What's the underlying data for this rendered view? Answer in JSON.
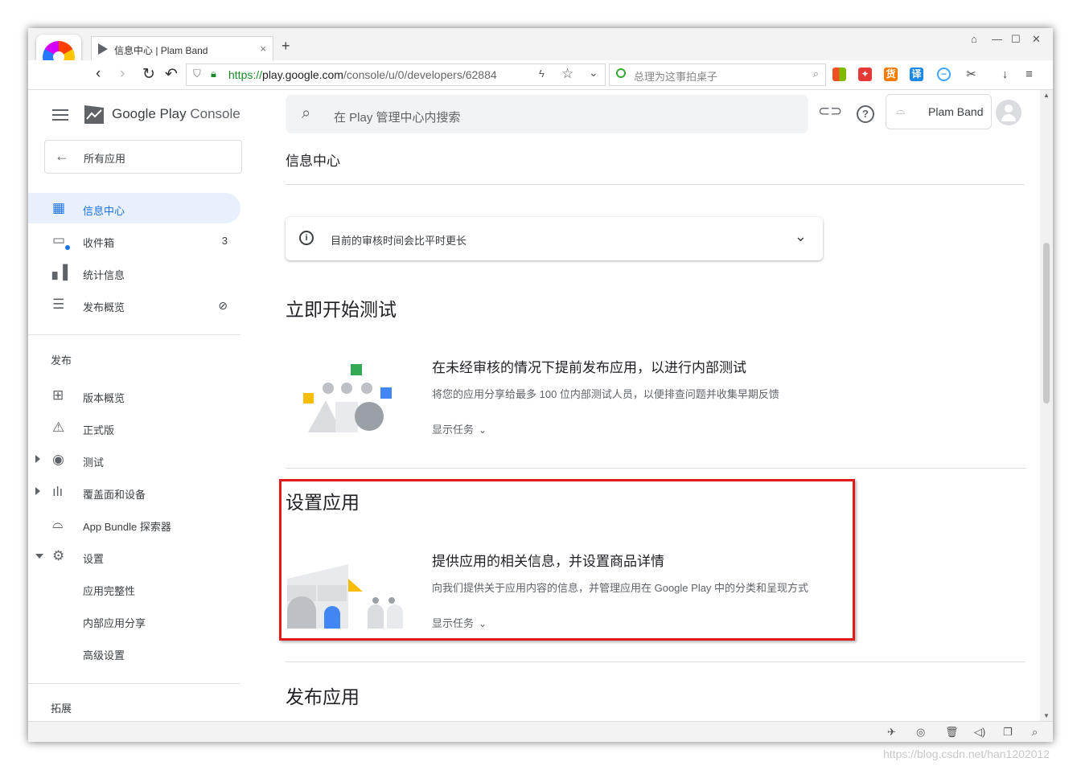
{
  "browser": {
    "tab_title": "信息中心 | Plam Band",
    "tab_close": "×",
    "new_tab": "+",
    "url_scheme": "https://",
    "url_host": "play.google.com",
    "url_path": "/console/u/0/developers/62884",
    "search_placeholder": "总理为这事拍桌子",
    "toolbar_icons": [
      "translate",
      "game",
      "deal",
      "translate-yi",
      "minus",
      "scissors",
      "download",
      "menu"
    ],
    "toolbar_glyphs": {
      "deal": "货",
      "translate": "译"
    }
  },
  "app": {
    "brand_main": "Google Play",
    "brand_sub": " Console",
    "all_apps": "所有应用",
    "search_placeholder": "在 Play 管理中心内搜索",
    "account_name": "Plam Band"
  },
  "sidebar": {
    "items": [
      {
        "label": "信息中心",
        "icon": "dashboard-icon"
      },
      {
        "label": "收件箱",
        "count": "3",
        "icon": "inbox-icon"
      },
      {
        "label": "统计信息",
        "icon": "stats-icon"
      },
      {
        "label": "发布概览",
        "icon": "release-overview-icon"
      }
    ],
    "section_release": "发布",
    "release_items": [
      {
        "label": "版本概览"
      },
      {
        "label": "正式版"
      },
      {
        "label": "测试"
      },
      {
        "label": "覆盖面和设备"
      },
      {
        "label": "App Bundle 探索器"
      },
      {
        "label": "设置"
      },
      {
        "label": "应用完整性"
      },
      {
        "label": "内部应用分享"
      },
      {
        "label": "高级设置"
      }
    ],
    "section_expand": "拓展"
  },
  "main": {
    "page_title": "信息中心",
    "notice": "目前的审核时间会比平时更长",
    "sections": [
      {
        "heading": "立即开始测试",
        "task_title": "在未经审核的情况下提前发布应用，以进行内部测试",
        "task_desc": "将您的应用分享给最多 100 位内部测试人员，以便排查问题并收集早期反馈",
        "show_tasks": "显示任务"
      },
      {
        "heading": "设置应用",
        "task_title": "提供应用的相关信息，并设置商品详情",
        "task_desc": "向我们提供关于应用内容的信息，并管理应用在 Google Play 中的分类和呈现方式",
        "show_tasks": "显示任务"
      },
      {
        "heading": "发布应用"
      }
    ]
  },
  "watermark": "https://blog.csdn.net/han1202012",
  "colors": {
    "accent": "#1a73e8",
    "highlight_box": "#e01b1b",
    "active_nav_bg": "#e8f0fe"
  }
}
